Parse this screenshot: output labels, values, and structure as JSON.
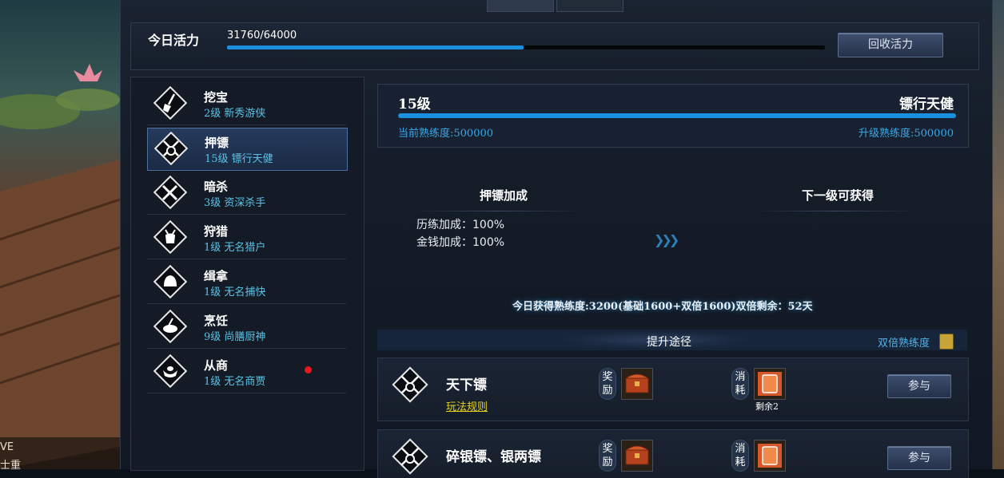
{
  "tabs": [
    "",
    ""
  ],
  "vitality": {
    "label": "今日活力",
    "value_text": "31760/64000",
    "progress": 0.496,
    "recycle_button": "回收活力"
  },
  "sidebar": {
    "items": [
      {
        "name": "挖宝",
        "sub": "2级 新秀游侠",
        "icon": "shovel-icon"
      },
      {
        "name": "押镖",
        "sub": "15级 镖行天健",
        "icon": "escort-icon"
      },
      {
        "name": "暗杀",
        "sub": "3级 资深杀手",
        "icon": "crossed-blades-icon"
      },
      {
        "name": "狩猎",
        "sub": "1级 无名猎户",
        "icon": "deer-icon"
      },
      {
        "name": "缉拿",
        "sub": "1级 无名捕快",
        "icon": "helmet-icon"
      },
      {
        "name": "烹饪",
        "sub": "9级 尚膳厨神",
        "icon": "cooking-pot-icon"
      },
      {
        "name": "从商",
        "sub": "1级 无名商贾",
        "icon": "ingot-icon"
      }
    ]
  },
  "level": {
    "level_text": "15级",
    "title": "镖行天健",
    "progress": 1.0,
    "current_exp": "当前熟练度:500000",
    "upgrade_exp": "升级熟练度:500000"
  },
  "bonus": {
    "title": "押镖加成",
    "next_title": "下一级可获得",
    "rows": [
      "历练加成：100%",
      "金钱加成：100%"
    ]
  },
  "today_text": "今日获得熟练度:3200(基础1600+双倍1600)双倍剩余：52天",
  "routes": {
    "title": "提升途径",
    "double_label": "双倍熟练度"
  },
  "tasks": [
    {
      "name": "天下镖",
      "rule": "玩法规则",
      "reward_tag": "奖励",
      "cost_tag": "消耗",
      "cost_remaining": "剩余2",
      "button": "参与"
    },
    {
      "name": "碎银镖、银两镖",
      "reward_tag": "奖励",
      "cost_tag": "消耗",
      "button": "参与"
    }
  ],
  "bottom_left": [
    "VE",
    "士重"
  ],
  "colors": {
    "accent": "#1b8fe0",
    "sub_text": "#59c2e6",
    "link": "#e6d420",
    "alert_dot": "#e8161d"
  }
}
